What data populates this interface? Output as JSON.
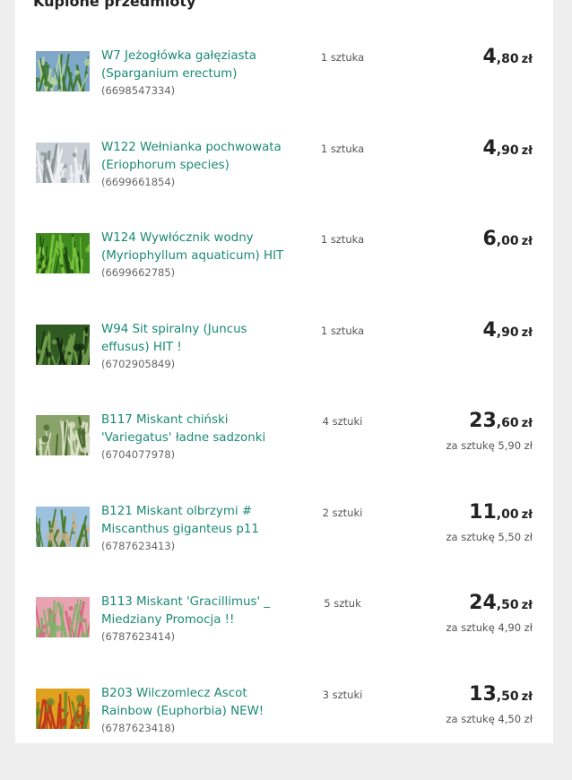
{
  "section_title": "Kupione przedmioty",
  "items": [
    {
      "name": "W7 Jeżogłówka gałęziasta (Sparganium erectum)",
      "offer_id": "(6698547334)",
      "quantity": "1 sztuka",
      "price_int": "4",
      "price_dec": ",80",
      "currency": "zł",
      "unit_price": "",
      "thumb_colors": [
        "#7fa7c9",
        "#3f7a32",
        "#b7d3a0"
      ]
    },
    {
      "name": "W122 Wełnianka pochwowata (Eriophorum species)",
      "offer_id": "(6699661854)",
      "quantity": "1 sztuka",
      "price_int": "4",
      "price_dec": ",90",
      "currency": "zł",
      "unit_price": "",
      "thumb_colors": [
        "#c9cfd6",
        "#eef0f2",
        "#8c9699"
      ]
    },
    {
      "name": "W124 Wywłócznik wodny (Myriophyllum aquaticum) HIT",
      "offer_id": "(6699662785)",
      "quantity": "1 sztuka",
      "price_int": "6",
      "price_dec": ",00",
      "currency": "zł",
      "unit_price": "",
      "thumb_colors": [
        "#3e8a1f",
        "#79c13a",
        "#1f4d12"
      ]
    },
    {
      "name": "W94 Sit spiralny (Juncus effusus) HIT !",
      "offer_id": "(6702905849)",
      "quantity": "1 sztuka",
      "price_int": "4",
      "price_dec": ",90",
      "currency": "zł",
      "unit_price": "",
      "thumb_colors": [
        "#2f5a22",
        "#6e9a4a",
        "#142b10"
      ]
    },
    {
      "name": "B117 Miskant chiński 'Variegatus' ładne sadzonki",
      "offer_id": "(6704077978)",
      "quantity": "4 sztuki",
      "price_int": "23",
      "price_dec": ",60",
      "currency": "zł",
      "unit_price": "za sztukę 5,90 zł",
      "thumb_colors": [
        "#8aa36b",
        "#d9dfc4",
        "#4a6b2e"
      ]
    },
    {
      "name": "B121 Miskant olbrzymi # Miscanthus giganteus p11",
      "offer_id": "(6787623413)",
      "quantity": "2 sztuki",
      "price_int": "11",
      "price_dec": ",00",
      "currency": "zł",
      "unit_price": "za sztukę 5,50 zł",
      "thumb_colors": [
        "#9cc2e0",
        "#4f7d2c",
        "#c9b089"
      ]
    },
    {
      "name": "B113 Miskant 'Gracillimus' _ Miedziany Promocja !!",
      "offer_id": "(6787623414)",
      "quantity": "5 sztuk",
      "price_int": "24",
      "price_dec": ",50",
      "currency": "zł",
      "unit_price": "za sztukę 4,90 zł",
      "thumb_colors": [
        "#e8a3b1",
        "#7fb36a",
        "#d46a7f"
      ]
    },
    {
      "name": "B203 Wilczomlecz Ascot Rainbow (Euphorbia) NEW!",
      "offer_id": "(6787623418)",
      "quantity": "3 sztuki",
      "price_int": "13",
      "price_dec": ",50",
      "currency": "zł",
      "unit_price": "za sztukę 4,50 zł",
      "thumb_colors": [
        "#e0a11f",
        "#c23a1c",
        "#6a8a2a"
      ]
    }
  ],
  "colors": {
    "link": "#1a8a73",
    "background": "#eeeeee",
    "card": "#ffffff"
  }
}
